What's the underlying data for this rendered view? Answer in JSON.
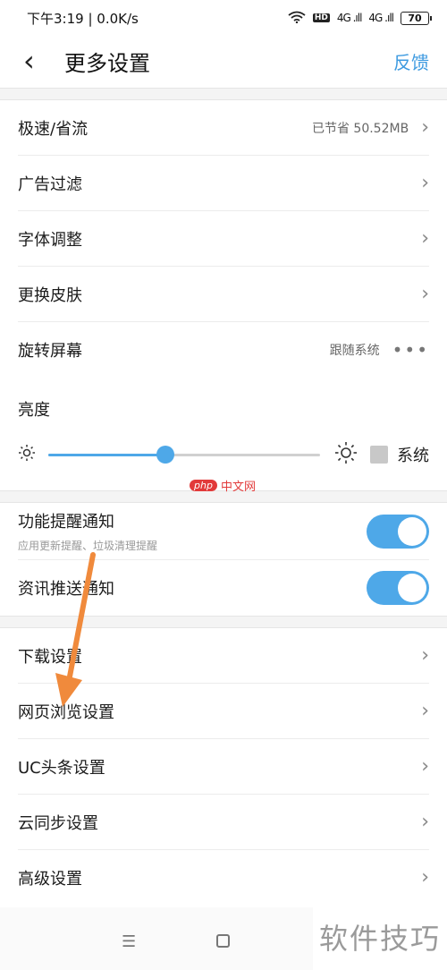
{
  "status_bar": {
    "time": "下午3:19 | 0.0K/s",
    "hd": "HD",
    "sig1": "4G .ıll",
    "sig2": "4G .ıll",
    "battery": "70"
  },
  "header": {
    "title": "更多设置",
    "feedback": "反馈",
    "back_icon": "chevron-left-icon"
  },
  "settings_group1": [
    {
      "label": "极速/省流",
      "value": "已节省 50.52MB",
      "accessory": "chevron"
    },
    {
      "label": "广告过滤",
      "accessory": "chevron"
    },
    {
      "label": "字体调整",
      "accessory": "chevron"
    },
    {
      "label": "更换皮肤",
      "accessory": "chevron"
    },
    {
      "label": "旋转屏幕",
      "value": "跟随系统",
      "accessory": "more-dots"
    }
  ],
  "brightness": {
    "label": "亮度",
    "level_fraction": 0.43,
    "system_label": "系统",
    "system_checked": false
  },
  "notifications": [
    {
      "label": "功能提醒通知",
      "sub": "应用更新提醒、垃圾清理提醒",
      "enabled": true
    },
    {
      "label": "资讯推送通知",
      "enabled": true
    }
  ],
  "settings_group2": [
    {
      "label": "下载设置"
    },
    {
      "label": "网页浏览设置"
    },
    {
      "label": "UC头条设置"
    },
    {
      "label": "云同步设置"
    },
    {
      "label": "高级设置"
    }
  ],
  "chevron_glyph": "›",
  "dots_glyph": "•••",
  "watermarks": {
    "php_pill": "php",
    "php_text": "中文网",
    "bottom": "软件技巧"
  },
  "nav": {
    "menu_glyph": "☰"
  },
  "colors": {
    "accent": "#4ea8e8",
    "arrow": "#f08a3c",
    "feedback": "#3d9ae0"
  }
}
